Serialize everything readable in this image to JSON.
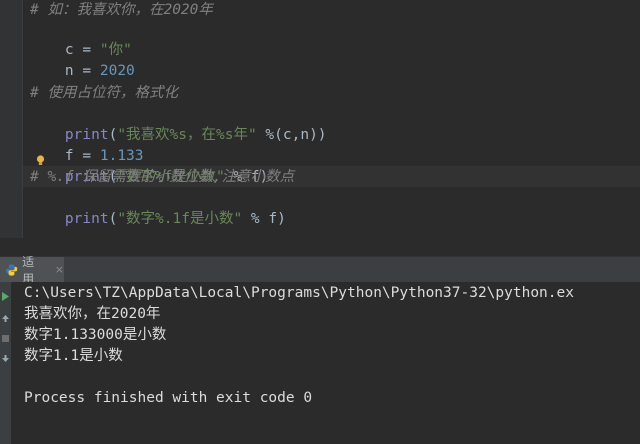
{
  "editor": {
    "line1": {
      "text": "# 如：我喜欢你，在2020年"
    },
    "line2": {
      "var": "c",
      "eq": " = ",
      "str": "\"你\""
    },
    "line3": {
      "var": "n",
      "eq": " = ",
      "num": "2020"
    },
    "line5": {
      "text": "# 使用占位符，格式化"
    },
    "line6": {
      "kw": "print",
      "open": "(",
      "str": "\"我喜欢%s，在%s年\"",
      "rest": " %(c,n))"
    },
    "line7": {
      "var": "f",
      "eq": " = ",
      "num": "1.133"
    },
    "line8": {
      "kw": "print",
      "open": "(",
      "str": "\"数字%f是小数\"",
      "rest": " % f)"
    },
    "line9": {
      "text": "# %.f 保留需要的小数位数,注意小数点"
    },
    "line10": {
      "kw": "print",
      "open": "(",
      "str": "\"数字%.1f是小数\"",
      "rest": " % f)"
    }
  },
  "run_panel": {
    "tab_label": "适用",
    "tab_close": "×"
  },
  "console": {
    "lines": [
      "C:\\Users\\TZ\\AppData\\Local\\Programs\\Python\\Python37-32\\python.ex",
      "我喜欢你，在2020年",
      "数字1.133000是小数",
      "数字1.1是小数",
      "",
      "Process finished with exit code 0"
    ]
  },
  "icons": {
    "python": "python-icon",
    "bulb": "intention-bulb-icon"
  },
  "colors": {
    "background": "#2b2b2b",
    "comment": "#808080",
    "string": "#6a8759",
    "number": "#6897bb",
    "keyword": "#8888c6",
    "text": "#a9b7c6"
  }
}
